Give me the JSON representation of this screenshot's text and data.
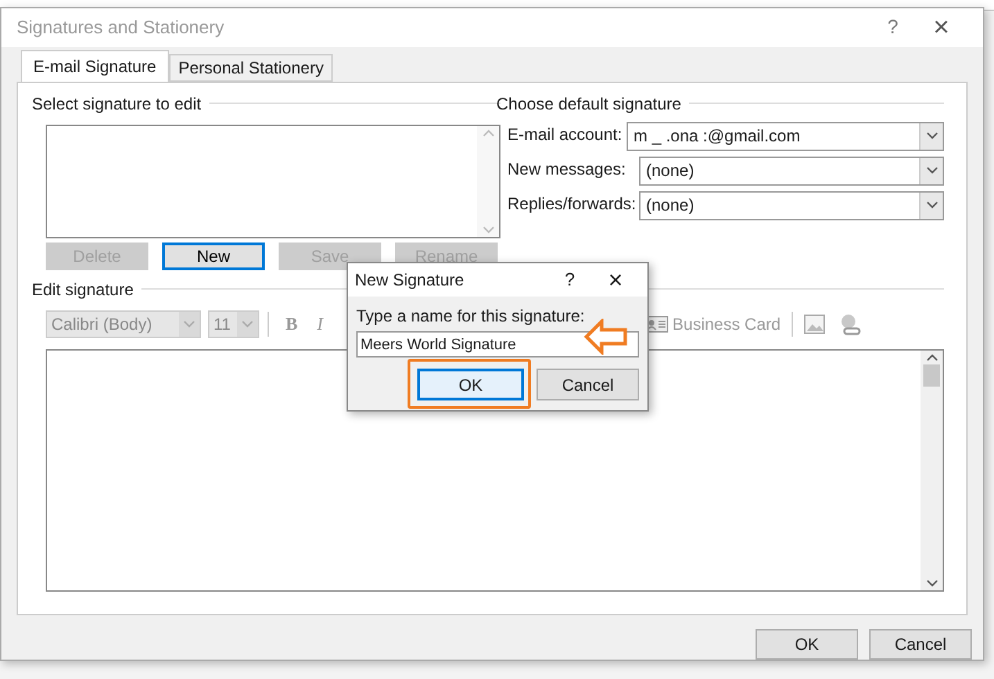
{
  "window": {
    "title": "Signatures and Stationery",
    "help": "?",
    "close": "×"
  },
  "tabs": [
    {
      "label": "E-mail Signature",
      "selected": true
    },
    {
      "label": "Personal Stationery",
      "selected": false
    }
  ],
  "select_section": {
    "heading": "Select signature to edit",
    "buttons": [
      {
        "label": "Delete",
        "disabled": true,
        "focused": false
      },
      {
        "label": "New",
        "disabled": false,
        "focused": true
      },
      {
        "label": "Save",
        "disabled": true,
        "focused": false
      },
      {
        "label": "Rename",
        "disabled": true,
        "focused": false
      }
    ]
  },
  "default_section": {
    "heading": "Choose default signature",
    "fields": [
      {
        "label": "E-mail account:",
        "value": "m _ .ona :@gmail.com"
      },
      {
        "label": "New messages:",
        "value": "(none)"
      },
      {
        "label": "Replies/forwards:",
        "value": "(none)"
      }
    ]
  },
  "edit_section": {
    "heading": "Edit signature",
    "font": "Calibri (Body)",
    "size": "11",
    "bold": "B",
    "italic": "I",
    "business_card": "Business Card"
  },
  "new_signature_dialog": {
    "title": "New Signature",
    "help": "?",
    "close": "×",
    "prompt": "Type a name for this signature:",
    "value": "Meers World Signature",
    "ok": "OK",
    "cancel": "Cancel"
  },
  "buttons": [
    "OK",
    "Cancel"
  ]
}
